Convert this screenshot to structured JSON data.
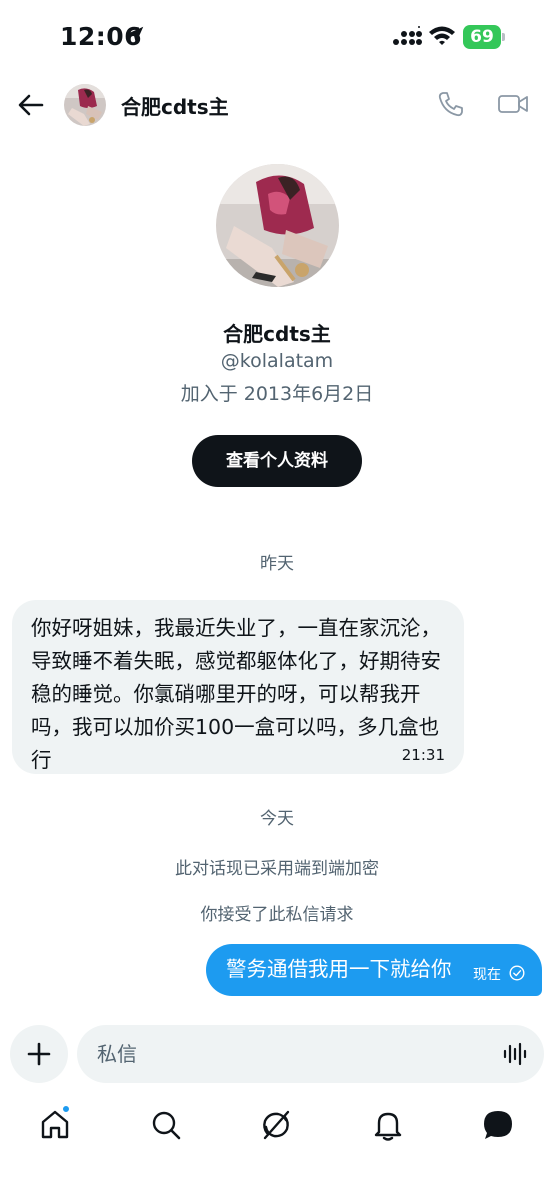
{
  "status_bar": {
    "time": "12:06",
    "battery": "69",
    "battery_color": "#34c759"
  },
  "header": {
    "name": "合肥cdts主",
    "icons": [
      "back-arrow-icon",
      "phone-icon",
      "video-camera-icon"
    ]
  },
  "profile": {
    "name": "合肥cdts主",
    "handle": "@kolalatam",
    "joined": "加入于 2013年6月2日",
    "view_profile_label": "查看个人资料"
  },
  "conversation": {
    "yesterday_label": "昨天",
    "incoming_message": {
      "text": "你好呀姐妹，我最近失业了，一直在家沉沦，导致睡不着失眠，感觉都躯体化了，好期待安稳的睡觉。你氯硝哪里开的呀，可以帮我开吗，我可以加价买100一盒可以吗，多几盒也行",
      "time": "21:31"
    },
    "today_label": "今天",
    "encryption_note": "此对话现已采用端到端加密",
    "accepted_note": "你接受了此私信请求",
    "outgoing_message": {
      "text": "警务通借我用一下就给你",
      "status": "现在"
    }
  },
  "composer": {
    "placeholder": "私信"
  },
  "tabbar": {
    "items": [
      "home-icon",
      "search-icon",
      "grok-icon",
      "bell-icon",
      "messages-icon"
    ]
  },
  "colors": {
    "accent": "#1d9bf0",
    "bubble_in": "#eff3f4",
    "secondary_text": "#536471"
  }
}
